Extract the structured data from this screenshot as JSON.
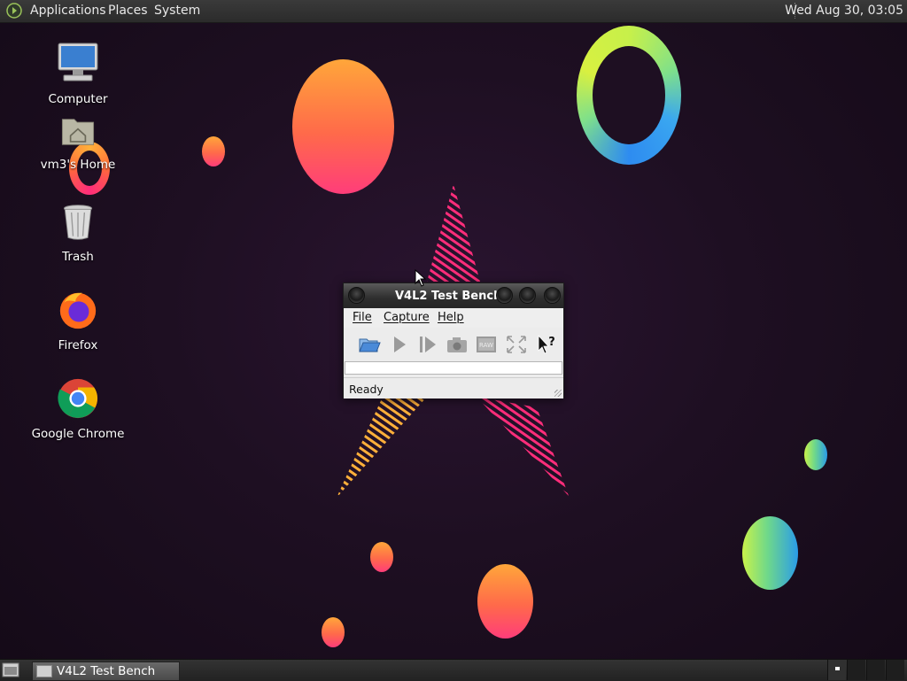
{
  "top_panel": {
    "menus": [
      "Applications",
      "Places",
      "System"
    ],
    "clock": "Wed Aug 30, 03:05"
  },
  "desktop_icons": [
    {
      "label": "Computer",
      "icon": "computer-icon"
    },
    {
      "label": "vm3's Home",
      "icon": "home-folder-icon"
    },
    {
      "label": "Trash",
      "icon": "trash-icon"
    },
    {
      "label": "Firefox",
      "icon": "firefox-icon"
    },
    {
      "label": "Google Chrome",
      "icon": "chrome-icon"
    }
  ],
  "window": {
    "title": "V4L2 Test Bench",
    "menus": [
      "File",
      "Capture",
      "Help"
    ],
    "toolbar": [
      "open-icon",
      "play-icon",
      "step-icon",
      "snapshot-icon",
      "raw-icon",
      "fullscreen-icon",
      "whats-this-icon"
    ],
    "raw_label": "RAW",
    "status": "Ready"
  },
  "taskbar": {
    "task_label": "V4L2 Test Bench"
  },
  "colors": {
    "accent_warm": "#ff6a4a",
    "accent_cool": "#2a9ce8",
    "panel": "#2b2b2b"
  }
}
